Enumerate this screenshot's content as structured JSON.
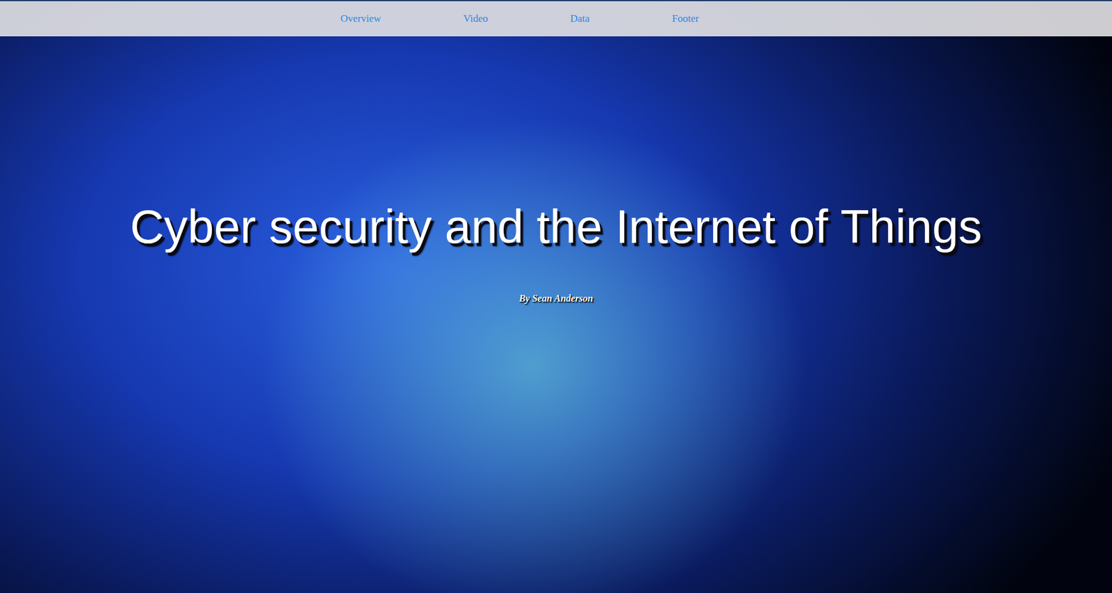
{
  "nav": {
    "links": [
      "Overview",
      "Video",
      "Data",
      "Footer"
    ]
  },
  "hero": {
    "title": "Cyber security and the Internet of Things",
    "byline": "By Sean Anderson"
  }
}
